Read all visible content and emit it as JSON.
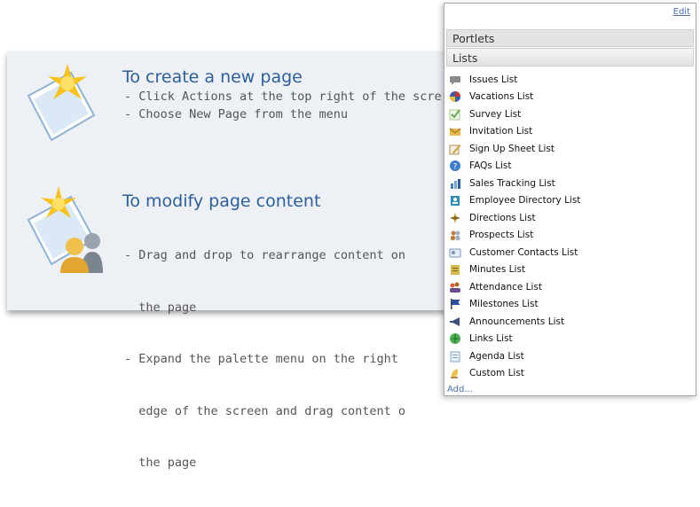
{
  "help": {
    "create": {
      "title": "To create a new page",
      "lines": [
        "- Click Actions at the top right of the scre",
        "- Choose New Page from the menu"
      ]
    },
    "modify": {
      "title": "To modify page content",
      "lines": [
        "- Drag and drop to rearrange content on",
        "  the page",
        "- Expand the palette menu on the right",
        "  edge of the screen and drag content o",
        "  the page"
      ]
    }
  },
  "palette": {
    "edit_label": "Edit",
    "portlets_label": "Portlets",
    "lists_label": "Lists",
    "add_label": "Add...",
    "items": [
      {
        "label": "Issues List",
        "icon": "speech-bubble-icon",
        "color": "#8a8a8a"
      },
      {
        "label": "Vacations List",
        "icon": "beach-ball-icon",
        "color": "#c0392b"
      },
      {
        "label": "Survey List",
        "icon": "checkmark-icon",
        "color": "#6aa84f"
      },
      {
        "label": "Invitation List",
        "icon": "envelope-icon",
        "color": "#e8b84a"
      },
      {
        "label": "Sign Up Sheet List",
        "icon": "pencil-sheet-icon",
        "color": "#b08d57"
      },
      {
        "label": "FAQs List",
        "icon": "question-globe-icon",
        "color": "#3d7cc9"
      },
      {
        "label": "Sales Tracking List",
        "icon": "chart-icon",
        "color": "#4a7fb5"
      },
      {
        "label": "Employee Directory List",
        "icon": "directory-icon",
        "color": "#2f8fb0"
      },
      {
        "label": "Directions List",
        "icon": "compass-icon",
        "color": "#c9a23a"
      },
      {
        "label": "Prospects List",
        "icon": "people-icon",
        "color": "#c27c3a"
      },
      {
        "label": "Customer Contacts List",
        "icon": "contact-card-icon",
        "color": "#7f95b5"
      },
      {
        "label": "Minutes List",
        "icon": "notepad-icon",
        "color": "#d4b94a"
      },
      {
        "label": "Attendance List",
        "icon": "group-icon",
        "color": "#b5651d"
      },
      {
        "label": "Milestones List",
        "icon": "flag-icon",
        "color": "#2c4f9e"
      },
      {
        "label": "Announcements List",
        "icon": "megaphone-icon",
        "color": "#3b4f7a"
      },
      {
        "label": "Links List",
        "icon": "link-globe-icon",
        "color": "#4caf50"
      },
      {
        "label": "Agenda List",
        "icon": "agenda-icon",
        "color": "#7ea3c9"
      },
      {
        "label": "Custom List",
        "icon": "custom-list-icon",
        "color": "#e8c24a"
      }
    ]
  }
}
